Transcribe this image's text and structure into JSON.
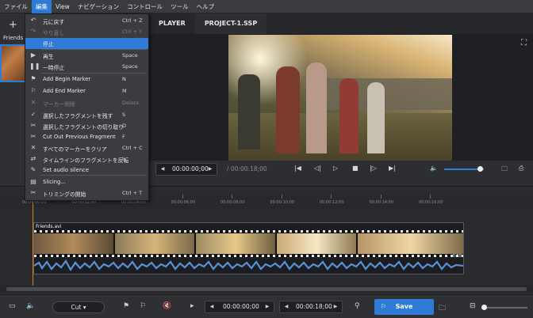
{
  "menubar": {
    "items": [
      "ファイル",
      "編集",
      "View",
      "ナビゲーション",
      "コントロール",
      "ツール",
      "ヘルプ"
    ]
  },
  "left_panel": {
    "file_label": "Friends"
  },
  "tabs": [
    "PLAYER",
    "PROJECT-1.SSP"
  ],
  "transport": {
    "current_time": "00:00:00;00",
    "total_time": "00:00:18;00",
    "volume_level": 0.9
  },
  "timeline": {
    "ticks": [
      "00:00:00;00",
      "00:00:02;00",
      "00:00:04;00",
      "00:00:06;00",
      "00:00:08;00",
      "00:00:10;00",
      "00:00:12;00",
      "00:00:14;00",
      "00:00:16;00"
    ],
    "clip_name": "Friends.avi",
    "clip_duration": "0:18"
  },
  "bottombar": {
    "mode": "Cut",
    "in_time": "00:00:00;00",
    "out_time": "00:00:18;00",
    "save_label": "Save"
  },
  "edit_menu": {
    "items": [
      {
        "icon": "undo-icon",
        "glyph": "↶",
        "label": "元に戻す",
        "shortcut": "Ctrl + Z",
        "disabled": false,
        "highlight": false
      },
      {
        "icon": "redo-icon",
        "glyph": "↷",
        "label": "やり直し",
        "shortcut": "Ctrl + Y",
        "disabled": true,
        "highlight": false
      },
      {
        "icon": "stop-icon",
        "glyph": "",
        "label": "停止",
        "shortcut": "",
        "disabled": false,
        "highlight": true
      },
      {
        "icon": "play-icon",
        "glyph": "▶",
        "label": "再生",
        "shortcut": "Space",
        "disabled": false,
        "highlight": false
      },
      {
        "icon": "pause-icon",
        "glyph": "❚❚",
        "label": "一時停止",
        "shortcut": "Space",
        "disabled": false,
        "highlight": false
      },
      {
        "icon": "begin-marker-icon",
        "glyph": "⚑",
        "label": "Add Begin Marker",
        "shortcut": "N",
        "disabled": false,
        "highlight": false
      },
      {
        "icon": "end-marker-icon",
        "glyph": "⚐",
        "label": "Add End Marker",
        "shortcut": "M",
        "disabled": false,
        "highlight": false
      },
      {
        "icon": "delete-marker-icon",
        "glyph": "✕",
        "label": "マーカー削除",
        "shortcut": "Delete",
        "disabled": true,
        "highlight": false
      },
      {
        "icon": "keep-fragment-icon",
        "glyph": "✓",
        "label": "選択したフラグメントを残す",
        "shortcut": "S",
        "disabled": false,
        "highlight": false
      },
      {
        "icon": "cut-fragment-icon",
        "glyph": "✂",
        "label": "選択したフラグメントの切り取り",
        "shortcut": "D",
        "disabled": false,
        "highlight": false
      },
      {
        "icon": "cut-previous-icon",
        "glyph": "✂",
        "label": "Cut Out Previous Fragment",
        "shortcut": "F",
        "disabled": false,
        "highlight": false
      },
      {
        "icon": "clear-markers-icon",
        "glyph": "✕",
        "label": "すべてのマーカーをクリア",
        "shortcut": "Ctrl + C",
        "disabled": false,
        "highlight": false
      },
      {
        "icon": "invert-fragments-icon",
        "glyph": "⇄",
        "label": "タイムラインのフラグメントを反転",
        "shortcut": "I",
        "disabled": false,
        "highlight": false
      },
      {
        "icon": "audio-silence-icon",
        "glyph": "✎",
        "label": "Set audio silence",
        "shortcut": "",
        "disabled": false,
        "highlight": false
      },
      {
        "icon": "slicing-icon",
        "glyph": "▤",
        "label": "Slicing...",
        "shortcut": "",
        "disabled": false,
        "highlight": false
      },
      {
        "icon": "start-trim-icon",
        "glyph": "✂",
        "label": "トリミングの開始",
        "shortcut": "Ctrl + T",
        "disabled": false,
        "highlight": false
      }
    ]
  },
  "colors": {
    "accent": "#2f7bd6",
    "playhead": "#e07a1b",
    "waveform": "#5b8fd6"
  }
}
